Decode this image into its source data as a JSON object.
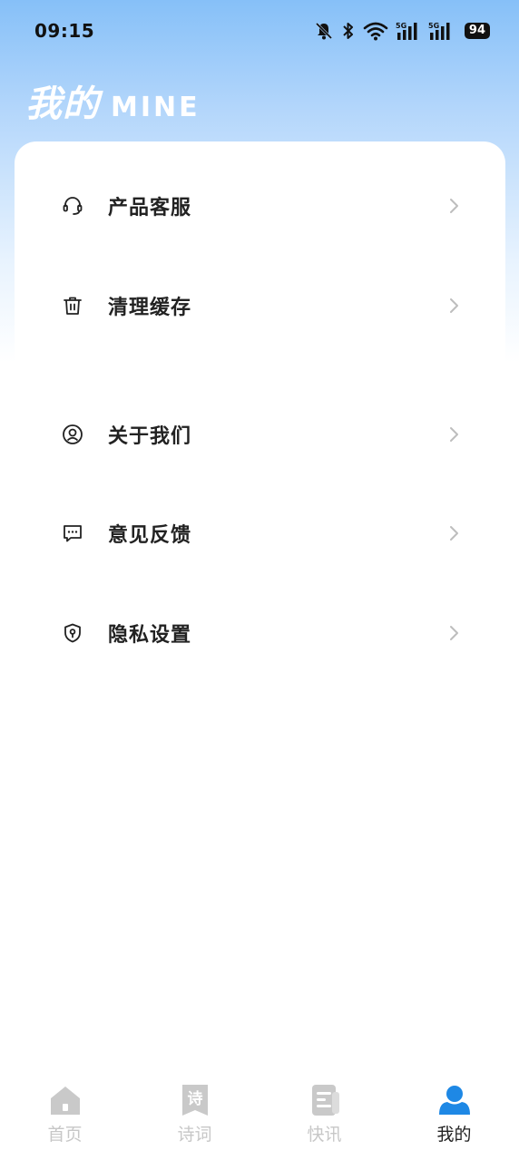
{
  "status_bar": {
    "time": "09:15",
    "signal_label_1": "5G",
    "signal_label_2": "5G",
    "battery": "94"
  },
  "header": {
    "title_cn": "我的",
    "title_en": "MINE"
  },
  "menu": [
    {
      "label": "产品客服",
      "icon": "headset-icon"
    },
    {
      "label": "清理缓存",
      "icon": "trash-icon"
    },
    {
      "label": "关于我们",
      "icon": "user-circle-icon"
    },
    {
      "label": "意见反馈",
      "icon": "chat-bubble-icon"
    },
    {
      "label": "隐私设置",
      "icon": "shield-icon"
    }
  ],
  "tabs": [
    {
      "label": "首页",
      "icon": "home-icon",
      "active": false
    },
    {
      "label": "诗词",
      "icon": "poem-bookmark-icon",
      "icon_text": "诗",
      "active": false
    },
    {
      "label": "快讯",
      "icon": "news-icon",
      "active": false
    },
    {
      "label": "我的",
      "icon": "profile-icon",
      "active": true
    }
  ],
  "colors": {
    "accent": "#1e88e5",
    "gradient_top": "#86c0f8",
    "inactive_tab": "#c7c7c7",
    "text_primary": "#222222"
  }
}
